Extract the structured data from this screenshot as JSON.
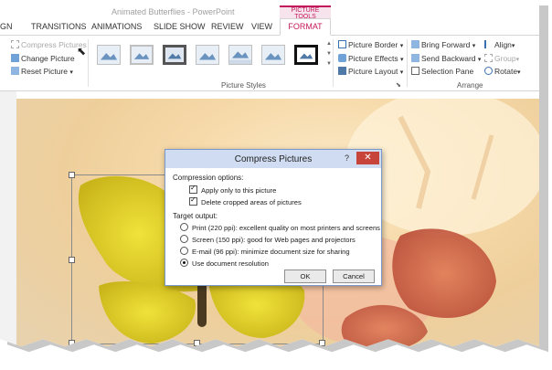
{
  "window": {
    "doc_title": "Animated Butterflies - PowerPoint",
    "tool_group_label": "PICTURE TOOLS"
  },
  "tabs": {
    "partial": "GN",
    "transitions": "TRANSITIONS",
    "animations": "ANIMATIONS",
    "slideshow": "SLIDE SHOW",
    "review": "REVIEW",
    "view": "VIEW",
    "format": "FORMAT"
  },
  "ribbon": {
    "adjust": {
      "compress": "Compress Pictures",
      "change": "Change Picture",
      "reset": "Reset Picture"
    },
    "styles_label": "Picture Styles",
    "border": "Picture Border",
    "effects": "Picture Effects",
    "layout": "Picture Layout",
    "arrange_label": "Arrange",
    "bring_forward": "Bring Forward",
    "send_backward": "Send Backward",
    "selection_pane": "Selection Pane",
    "align": "Align",
    "group": "Group",
    "rotate": "Rotate"
  },
  "dialog": {
    "title": "Compress Pictures",
    "help": "?",
    "close": "✕",
    "compression_label": "Compression options:",
    "apply_only": "Apply only to this picture",
    "delete_cropped": "Delete cropped areas of pictures",
    "target_label": "Target output:",
    "print": "Print (220 ppi): excellent quality on most printers and screens",
    "screen": "Screen (150 ppi): good for Web pages and projectors",
    "email": "E-mail (96 ppi): minimize document size for sharing",
    "use_doc": "Use document resolution",
    "ok": "OK",
    "cancel": "Cancel"
  },
  "colors": {
    "accent": "#c2185b",
    "dialog_title": "#cfdcf1",
    "close_button": "#c7443b"
  }
}
